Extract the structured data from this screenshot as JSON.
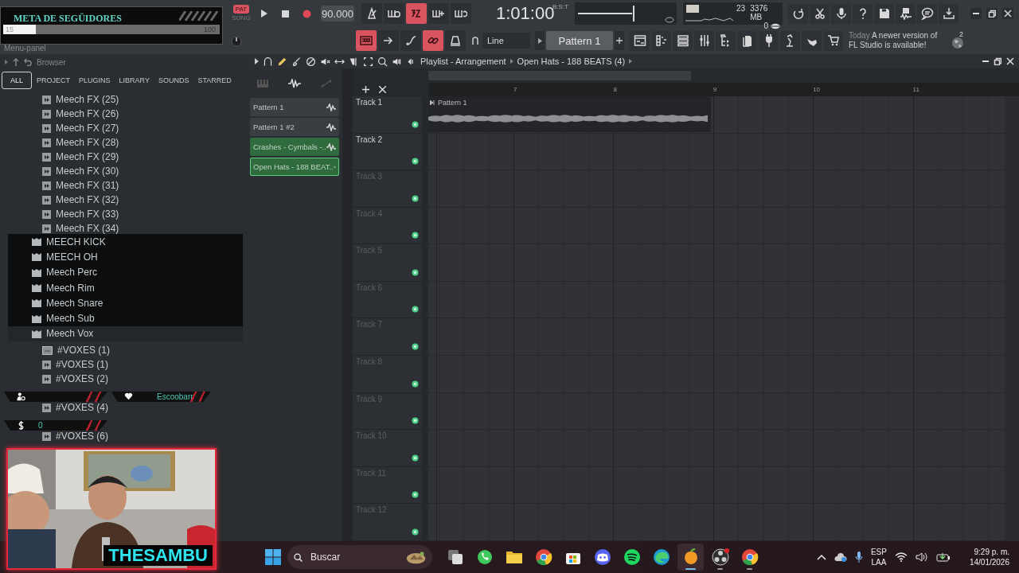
{
  "toolbar": {
    "menu_label": "Menu-panel",
    "mode": [
      {
        "label": "PAT",
        "selected": true
      },
      {
        "label": "SONG",
        "selected": false
      }
    ],
    "tempo": "90.000",
    "recording_toggles": [
      {
        "kind": "metronome",
        "on": false
      },
      {
        "kind": "wait",
        "on": false
      },
      {
        "kind": "countdown",
        "on": true
      },
      {
        "kind": "blend",
        "on": false
      },
      {
        "kind": "loop",
        "on": false
      }
    ],
    "time": "1:01:00",
    "time_format": "B:S:T",
    "cpu": "23",
    "memory": "3376 MB",
    "polyphony": "0",
    "edit_toggles": [
      {
        "kind": "typing-keyboard",
        "on": true
      },
      {
        "kind": "step",
        "on": false
      },
      {
        "kind": "slide",
        "on": false
      },
      {
        "kind": "link",
        "on": true
      },
      {
        "kind": "knob",
        "on": false
      }
    ],
    "snap": "Line",
    "pattern": "Pattern 1",
    "news": {
      "date": "Today",
      "message": "A newer version of FL Studio is available!",
      "count": "2"
    }
  },
  "browser": {
    "title": "Browser",
    "tabs": [
      {
        "label": "ALL",
        "selected": true
      },
      {
        "label": "PROJECT",
        "selected": false
      },
      {
        "label": "PLUGINS",
        "selected": false
      },
      {
        "label": "LIBRARY",
        "selected": false
      },
      {
        "label": "SOUNDS",
        "selected": false
      },
      {
        "label": "STARRED",
        "selected": false
      }
    ],
    "tree": [
      {
        "children": [
          {
            "label": "Meech FX (25)",
            "kind": "audio"
          },
          {
            "label": "Meech FX (26)",
            "kind": "audio"
          },
          {
            "label": "Meech FX (27)",
            "kind": "audio"
          },
          {
            "label": "Meech FX (28)",
            "kind": "audio"
          },
          {
            "label": "Meech FX (29)",
            "kind": "audio"
          },
          {
            "label": "Meech FX (30)",
            "kind": "audio"
          },
          {
            "label": "Meech FX (31)",
            "kind": "audio"
          },
          {
            "label": "Meech FX (32)",
            "kind": "audio"
          },
          {
            "label": "Meech FX (33)",
            "kind": "audio"
          },
          {
            "label": "Meech FX (34)",
            "kind": "audio"
          }
        ]
      },
      {
        "label": "MEECH KICK",
        "kind": "folder",
        "selected": false
      },
      {
        "label": "MEECH OH",
        "kind": "folder",
        "selected": false
      },
      {
        "label": "Meech Perc",
        "kind": "folder",
        "selected": false
      },
      {
        "label": "Meech Rim",
        "kind": "folder",
        "selected": false
      },
      {
        "label": "Meech Snare",
        "kind": "folder",
        "selected": false
      },
      {
        "label": "Meech Sub",
        "kind": "folder",
        "selected": false
      },
      {
        "label": "Meech Vox",
        "kind": "folder",
        "selected": true,
        "children": [
          {
            "label": "#VOXES (1)",
            "kind": "mp3"
          },
          {
            "label": "#VOXES (1)",
            "kind": "audio"
          },
          {
            "label": "#VOXES (2)",
            "kind": "audio"
          },
          {
            "label": "#VOXES (4)",
            "kind": "audio"
          },
          {
            "label": "#VOXES (6)",
            "kind": "audio"
          }
        ]
      }
    ]
  },
  "playlist": {
    "title": "Playlist - Arrangement",
    "current_pattern": "Open Hats - 188 BEATS (4)",
    "patterns": [
      {
        "label": "Pattern 1",
        "color": "#3a3d41",
        "selected": false
      },
      {
        "label": "Pattern 1 #2",
        "color": "#3a3d41",
        "selected": false
      },
      {
        "label": "Crashes  - Cymbals -..",
        "color": "#2f6b3c",
        "selected": false
      },
      {
        "label": "Open Hats - 188 BEAT..",
        "color": "#2f6b3c",
        "selected": true
      }
    ],
    "ruler": [
      "7",
      "8",
      "9",
      "10",
      "11"
    ],
    "tracks": [
      {
        "name": "Track 1",
        "active": true,
        "clips": [
          {
            "label": "Pattern 1"
          }
        ]
      },
      {
        "name": "Track 2",
        "active": true
      },
      {
        "name": "Track 3",
        "active": false
      },
      {
        "name": "Track 4",
        "active": false
      },
      {
        "name": "Track 5",
        "active": false
      },
      {
        "name": "Track 6",
        "active": false
      },
      {
        "name": "Track 7",
        "active": false
      },
      {
        "name": "Track 8",
        "active": false
      },
      {
        "name": "Track 9",
        "active": false
      },
      {
        "name": "Track 10",
        "active": false
      },
      {
        "name": "Track 11",
        "active": false
      },
      {
        "name": "Track 12",
        "active": false
      }
    ]
  },
  "overlay": {
    "goal": {
      "title": "META DE SEGÜIDORES",
      "current": "15",
      "target": "100",
      "level": 0.15
    },
    "stats": [
      {
        "kind": "member"
      },
      {
        "kind": "follower",
        "value": "Escoobarr"
      },
      {
        "kind": "tip",
        "value": "0"
      }
    ],
    "webcam": {
      "kind": "picture",
      "caption": "THESAMBU"
    }
  },
  "taskbar": {
    "search_placeholder": "Buscar",
    "apps": [
      {
        "kind": "task-view",
        "running": false,
        "selected": false
      },
      {
        "kind": "chat",
        "running": false,
        "selected": false
      },
      {
        "kind": "folder",
        "running": false,
        "selected": false
      },
      {
        "kind": "chrome",
        "running": false,
        "selected": false
      },
      {
        "kind": "store",
        "running": false,
        "selected": false
      },
      {
        "kind": "discord",
        "running": false,
        "selected": false
      },
      {
        "kind": "music",
        "running": false,
        "selected": false
      },
      {
        "kind": "edge",
        "running": false,
        "selected": false
      },
      {
        "kind": "fruit",
        "running": true,
        "selected": true
      },
      {
        "kind": "obs",
        "running": true,
        "selected": false
      },
      {
        "kind": "chrome",
        "running": true,
        "selected": false
      }
    ],
    "language": "ESP",
    "layout": "LAA",
    "time": "9:29 p. m.",
    "date": "14/01/2026"
  }
}
